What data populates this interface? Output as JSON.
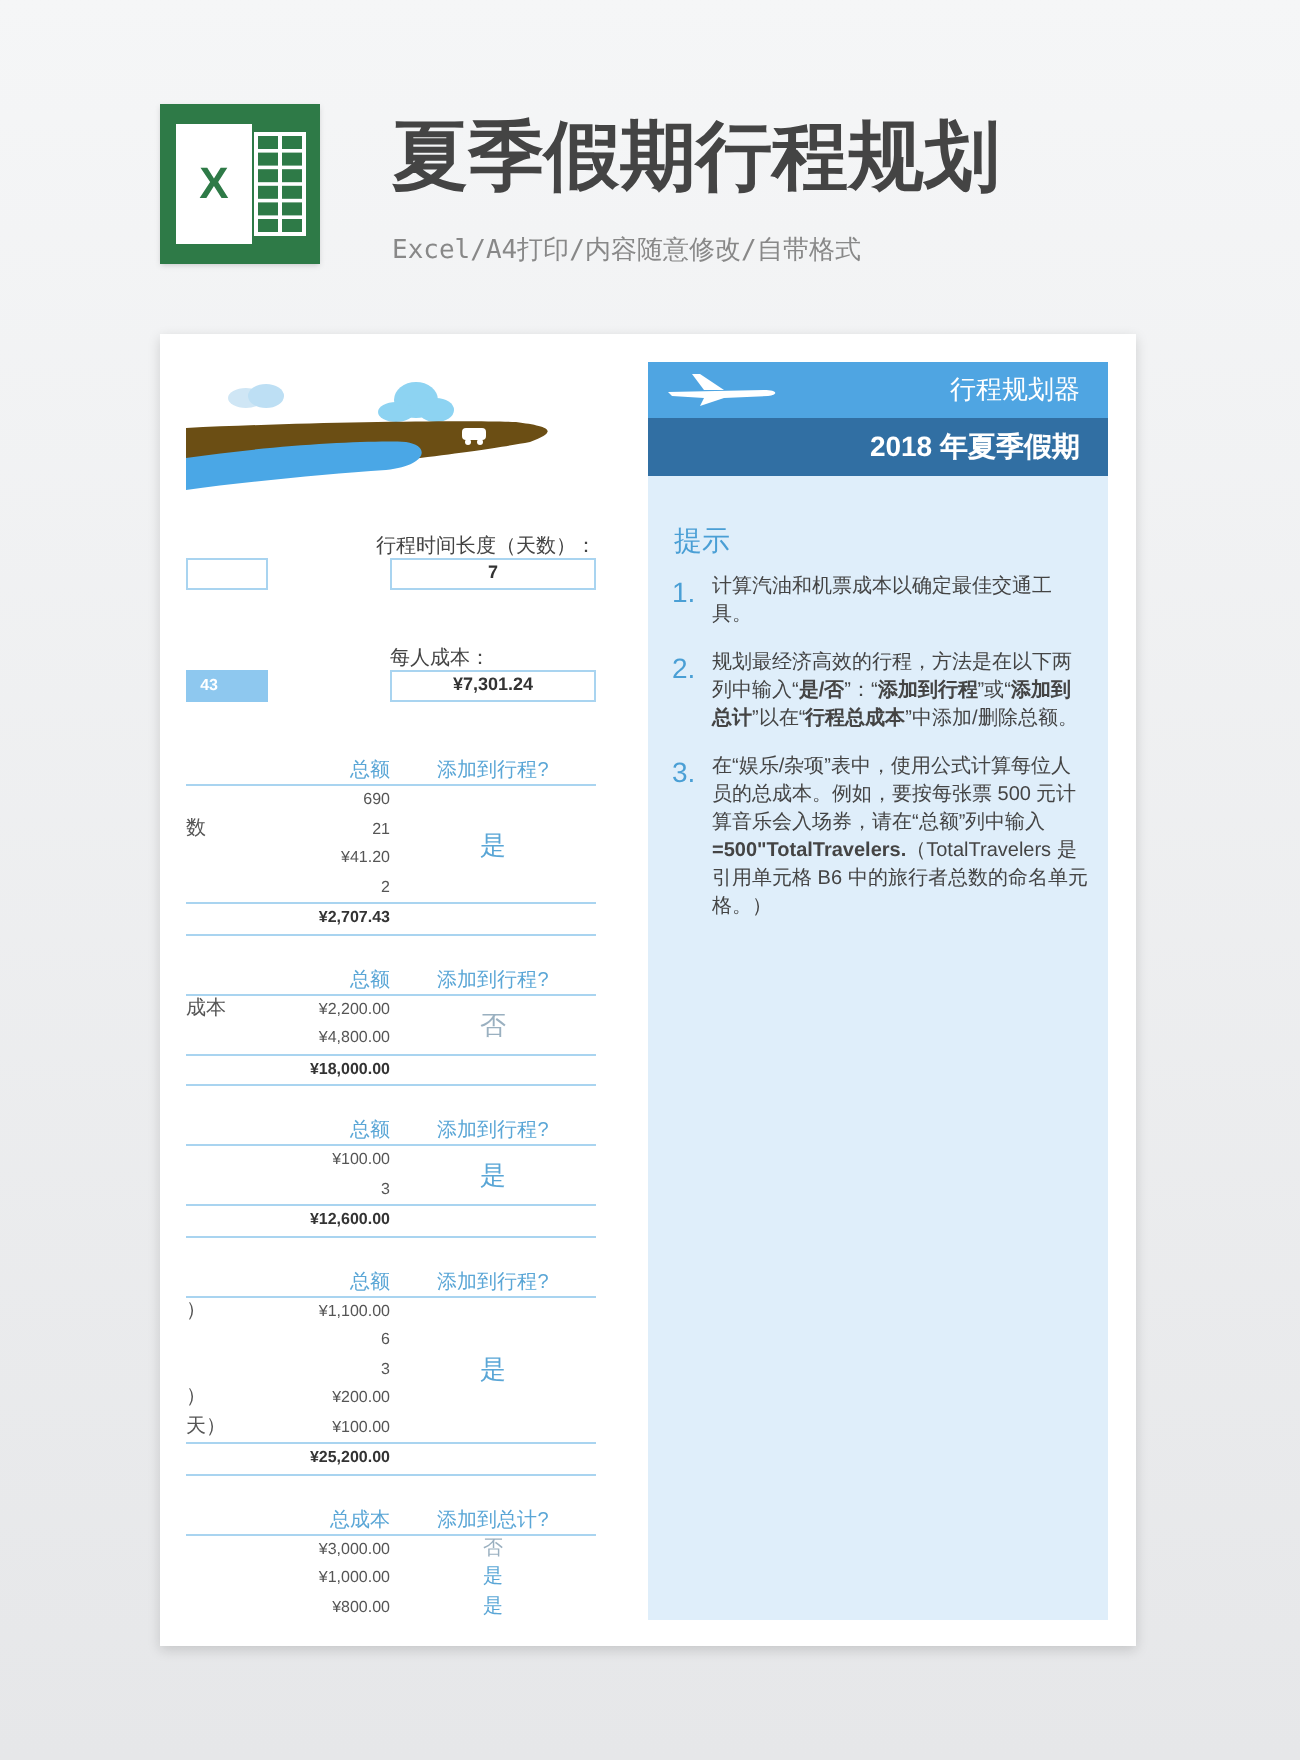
{
  "header": {
    "logo_letter": "X",
    "title": "夏季假期行程规划",
    "subtitle": "Excel/A4打印/内容随意修改/自带格式"
  },
  "sheet": {
    "fields": [
      {
        "label": "行程时间长度（天数）：",
        "value": "7",
        "side_filled": false
      },
      {
        "label": "每人成本：",
        "value": "¥7,301.24",
        "side_value": "43",
        "side_filled": true
      }
    ],
    "sections": [
      {
        "kind": "grouped",
        "columns": [
          "总额",
          "添加到行程?"
        ],
        "rows": [
          {
            "label": "",
            "value": "690"
          },
          {
            "label": "数",
            "value": "21"
          },
          {
            "label": "",
            "value": "¥41.20"
          },
          {
            "label": "",
            "value": "2"
          }
        ],
        "total": "¥2,707.43",
        "decision": "是",
        "selected": true
      },
      {
        "kind": "grouped",
        "columns": [
          "总额",
          "添加到行程?"
        ],
        "rows": [
          {
            "label": "成本",
            "value": "¥2,200.00"
          },
          {
            "label": "",
            "value": "¥4,800.00"
          }
        ],
        "total": "¥18,000.00",
        "decision": "否",
        "selected": false
      },
      {
        "kind": "grouped",
        "columns": [
          "总额",
          "添加到行程?"
        ],
        "rows": [
          {
            "label": "",
            "value": "¥100.00"
          },
          {
            "label": "",
            "value": "3"
          }
        ],
        "total": "¥12,600.00",
        "decision": "是",
        "selected": true
      },
      {
        "kind": "grouped",
        "columns": [
          "总额",
          "添加到行程?"
        ],
        "rows": [
          {
            "label": "）",
            "value": "¥1,100.00"
          },
          {
            "label": "",
            "value": "6"
          },
          {
            "label": "",
            "value": "3"
          },
          {
            "label": "）",
            "value": "¥200.00"
          },
          {
            "label": "天）",
            "value": "¥100.00"
          }
        ],
        "total": "¥25,200.00",
        "decision": "是",
        "selected": true
      },
      {
        "kind": "itemized",
        "columns": [
          "总成本",
          "添加到总计?"
        ],
        "rows": [
          {
            "label": "",
            "value": "¥3,000.00",
            "decision": "否",
            "selected": false
          },
          {
            "label": "",
            "value": "¥1,000.00",
            "decision": "是",
            "selected": true
          },
          {
            "label": "",
            "value": "¥800.00",
            "decision": "是",
            "selected": true
          }
        ]
      }
    ]
  },
  "panel": {
    "app_title": "行程规划器",
    "trip_title": "2018 年夏季假期",
    "tips_heading": "提示",
    "tips": [
      {
        "number": "1.",
        "text": "计算汽油和机票成本以确定最佳交通工具。"
      },
      {
        "number": "2.",
        "text": "规划最经济高效的行程，方法是在以下两列中输入“**是/否**”：“**添加到行程**”或“**添加到总计**”以在“**行程总成本**”中添加/删除总额。"
      },
      {
        "number": "3.",
        "text": "在“娱乐/杂项”表中，使用公式计算每位人员的总成本。例如，要按每张票 500 元计算音乐会入场券，请在“总额”列中输入 **=500\"TotalTravelers.**（TotalTravelers 是引用单元格 B6 中的旅行者总数的命名单元格。）"
      }
    ]
  }
}
